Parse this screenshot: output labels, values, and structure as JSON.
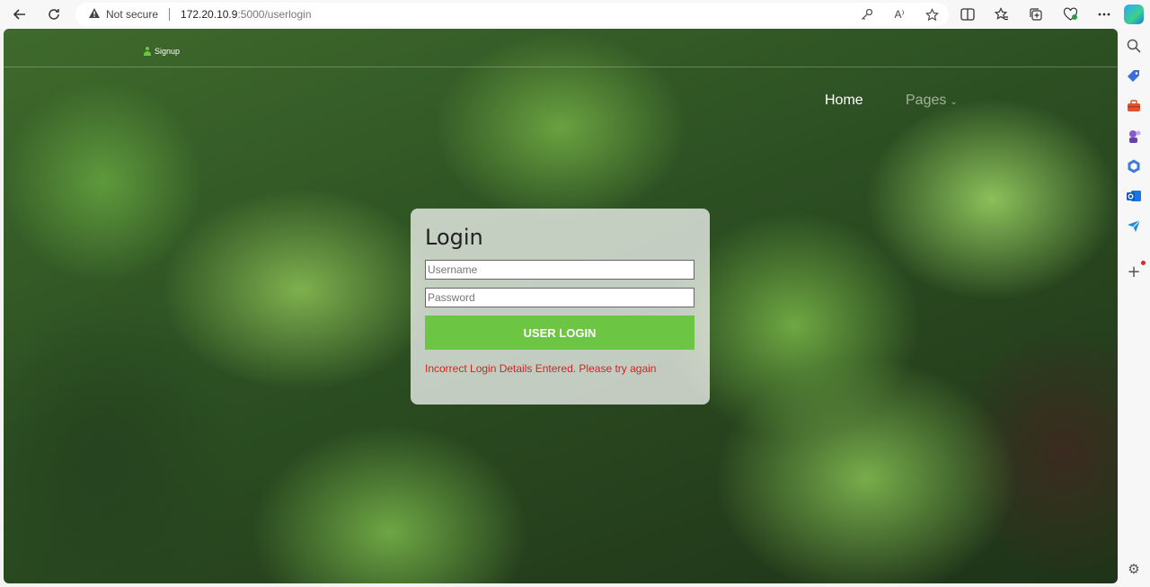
{
  "browser": {
    "security_label": "Not secure",
    "url_host": "172.20.10.9",
    "url_rest": ":5000/userlogin",
    "read_aloud_label": "A⁾"
  },
  "header": {
    "signup_label": "Signup",
    "nav": {
      "home": "Home",
      "pages": "Pages"
    }
  },
  "login": {
    "title": "Login",
    "username_placeholder": "Username",
    "password_placeholder": "Password",
    "button_label": "USER LOGIN",
    "error_message": "Incorrect Login Details Entered. Please try again"
  },
  "colors": {
    "accent": "#6cc644",
    "error": "#d9211b"
  }
}
